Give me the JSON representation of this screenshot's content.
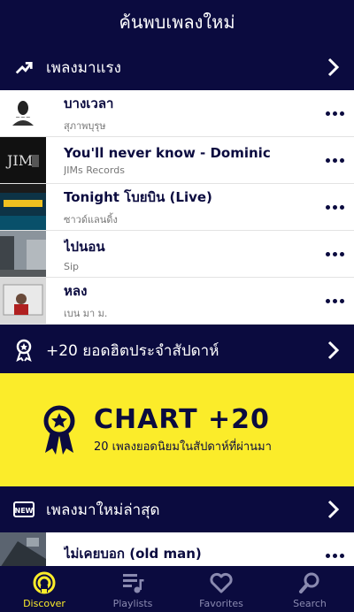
{
  "header": {
    "title": "ค้นพบเพลงใหม่"
  },
  "sections": {
    "trending": {
      "label": "เพลงมาแรง",
      "icon": "trending-up-icon"
    },
    "weekly": {
      "label": "+20 ยอดฮิตประจำสัปดาห์",
      "icon": "award-icon"
    },
    "newest": {
      "label": "เพลงมาใหม่ล่าสุด",
      "icon": "new-badge-icon"
    }
  },
  "trending_songs": [
    {
      "title": "บางเวลา",
      "artist": "สุภาพบุรุษ"
    },
    {
      "title": "You'll never know - Dominic",
      "artist": "JIMs Records"
    },
    {
      "title": "Tonight โบยบิน (Live)",
      "artist": "ซาวด์แลนดิ้ง"
    },
    {
      "title": "ไปนอน",
      "artist": "Sip"
    },
    {
      "title": "หลง",
      "artist": "เบน มา ม."
    }
  ],
  "banner": {
    "title": "CHART +20",
    "subtitle": "20 เพลงยอดนิยมในสัปดาห์ที่ผ่านมา"
  },
  "new_songs": [
    {
      "title": "ไม่เคยบอก (old man)",
      "artist": ""
    }
  ],
  "tabs": [
    {
      "label": "Discover",
      "icon": "discover-icon",
      "active": true
    },
    {
      "label": "Playlists",
      "icon": "playlists-icon",
      "active": false
    },
    {
      "label": "Favorites",
      "icon": "heart-icon",
      "active": false
    },
    {
      "label": "Search",
      "icon": "search-icon",
      "active": false
    }
  ],
  "colors": {
    "navy": "#0b0b3f",
    "accent": "#fbec2a",
    "inactive": "#8a8ab0"
  }
}
